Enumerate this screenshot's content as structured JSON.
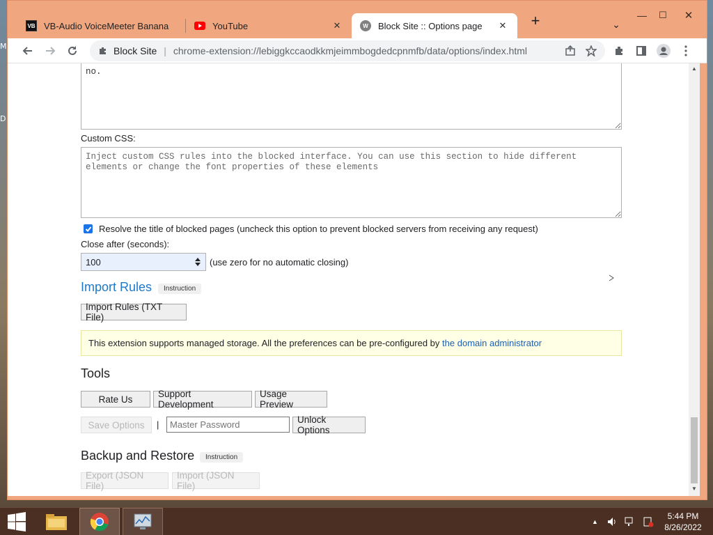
{
  "desktop": {
    "side_letters": [
      "M",
      "D"
    ]
  },
  "browser": {
    "window_controls": {
      "minimize": "—",
      "maximize": "☐",
      "close": "✕"
    },
    "tabs": [
      {
        "label": "VB-Audio VoiceMeeter Banana",
        "icon": "vb-audio-icon",
        "close": "✕"
      },
      {
        "label": "YouTube",
        "icon": "youtube-icon",
        "close": "✕"
      },
      {
        "label": "Block Site :: Options page",
        "icon": "block-site-icon",
        "close": "✕",
        "active": true
      }
    ],
    "new_tab": "+",
    "tab_menu": "⌄",
    "address": {
      "site_name": "Block Site",
      "separator": "|",
      "url": "chrome-extension://lebiggkccaodkkmjeimmbogdedcpnmfb/data/options/index.html"
    }
  },
  "page": {
    "top_textarea_value": "no.",
    "custom_css": {
      "label": "Custom CSS:",
      "placeholder": "Inject custom CSS rules into the blocked interface. You can use this section to hide different elements or change the font properties of these elements"
    },
    "resolve_title": {
      "checked": true,
      "label": "Resolve the title of blocked pages (uncheck this option to prevent blocked servers from receiving any request)"
    },
    "close_after": {
      "label": "Close after (seconds):",
      "value": "100",
      "hint": "(use zero for no automatic closing)"
    },
    "import_rules": {
      "title": "Import Rules",
      "badge": "Instruction",
      "button": "Import Rules (TXT File)"
    },
    "notice": {
      "text": "This extension supports managed storage. All the preferences can be pre-configured by",
      "link": "the domain administrator"
    },
    "tools": {
      "title": "Tools",
      "rate_us": "Rate Us",
      "support": "Support Development",
      "usage_preview": "Usage Preview",
      "save_options": "Save Options",
      "pipe": "|",
      "password_placeholder": "Master Password",
      "unlock": "Unlock Options"
    },
    "backup": {
      "title": "Backup and Restore",
      "badge": "Instruction",
      "export": "Export (JSON File)",
      "import": "Import (JSON File)"
    }
  },
  "taskbar": {
    "time": "5:44 PM",
    "date": "8/26/2022"
  }
}
